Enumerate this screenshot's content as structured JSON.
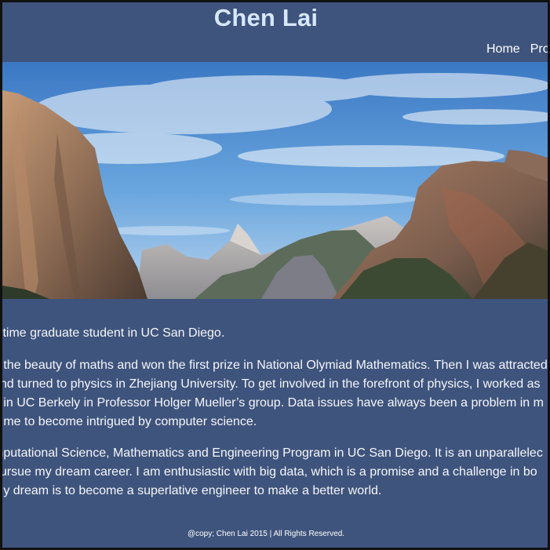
{
  "header": {
    "title": "Chen Lai"
  },
  "nav": {
    "items": [
      "Home",
      "Pro"
    ]
  },
  "hero": {
    "image_name": "yosemite-valley-landscape",
    "sky_color": "#5b9ad8",
    "rock_color": "#9a7a62"
  },
  "main": {
    "paragraph_1": {
      "line_1": "ll-time graduate student in UC San Diego."
    },
    "paragraph_2": {
      "line_1": "o the beauty of maths and won the first prize in National Olymiad Mathematics. Then I was attracted",
      "line_2": " and turned to physics in Zhejiang University. To get involved in the forefront of physics, I worked as",
      "line_3": "n in UC Berkely in Professor Holger Mueller’s group. Data issues have always been a problem in m",
      "line_4": "d me to become intrigued by computer science."
    },
    "paragraph_3": {
      "line_1": "mputational Science, Mathematics and Engineering Program in UC San Diego. It is an unparallelec",
      "line_2": " pursue my dream career. I am enthusiastic with big data, which is a promise and a challenge in bo",
      "line_3": " My dream is to become a superlative engineer to make a better world."
    }
  },
  "footer": {
    "text": "@copy; Chen Lai 2015 | All Rights Reserved."
  },
  "colors": {
    "page_background": "#3f547c",
    "title": "#d7e7ff",
    "text": "#f4f6fb"
  }
}
